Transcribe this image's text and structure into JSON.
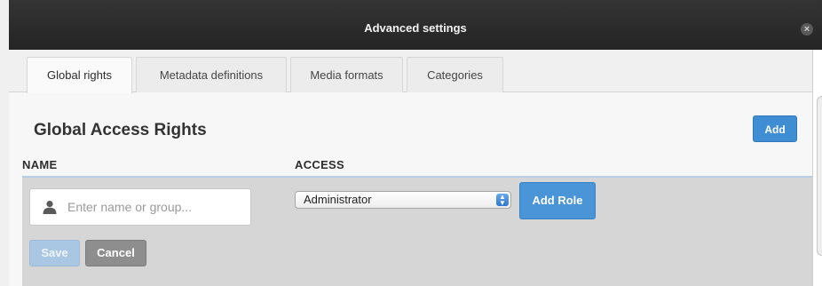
{
  "dialog": {
    "title": "Advanced settings",
    "close_glyph": "×"
  },
  "tabs": [
    {
      "label": "Global rights",
      "active": true
    },
    {
      "label": "Metadata definitions",
      "active": false
    },
    {
      "label": "Media formats",
      "active": false
    },
    {
      "label": "Categories",
      "active": false
    }
  ],
  "section": {
    "heading": "Global Access Rights",
    "add_label": "Add"
  },
  "columns": {
    "name": "NAME",
    "access": "ACCESS"
  },
  "form": {
    "name_placeholder": "Enter name or group...",
    "name_value": "",
    "access_value": "Administrator",
    "add_role_label": "Add Role",
    "save_label": "Save",
    "cancel_label": "Cancel"
  },
  "icons": {
    "user": "user-icon",
    "close": "close-icon",
    "select": "select-stepper-icon"
  },
  "colors": {
    "titlebar": "#2b2b2b",
    "primary_button": "#3f8ed4",
    "disabled_button": "#a9c6e2",
    "cancel_button": "#8e8e8e",
    "form_background": "#d6d6d6"
  }
}
